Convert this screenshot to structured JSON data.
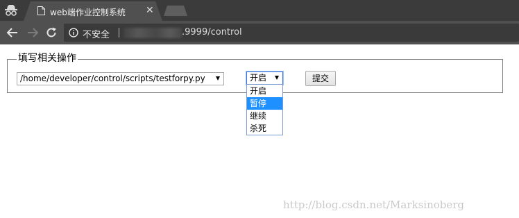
{
  "browser": {
    "tab": {
      "title": "web端作业控制系统",
      "close_icon": "close-icon",
      "favicon": "document-icon"
    },
    "incognito_icon": "incognito-icon",
    "nav": {
      "back_icon": "back-arrow-icon",
      "forward_icon": "forward-arrow-icon",
      "reload_icon": "reload-icon"
    },
    "omnibox": {
      "security_text": "不安全",
      "url_visible": ".9999/control"
    }
  },
  "form": {
    "legend": "填写相关操作",
    "script_select": {
      "value": "/home/developer/control/scripts/testforpy.py"
    },
    "action_select": {
      "value": "开启",
      "options": [
        "开启",
        "暂停",
        "继续",
        "杀死"
      ],
      "highlighted": "暂停"
    },
    "submit_label": "提交"
  },
  "watermark": "http://blog.csdn.net/Marksinoberg",
  "colors": {
    "chrome_dark": "#3b3b3b",
    "chrome_toolbar": "#505050",
    "highlight": "#1e90ff"
  }
}
